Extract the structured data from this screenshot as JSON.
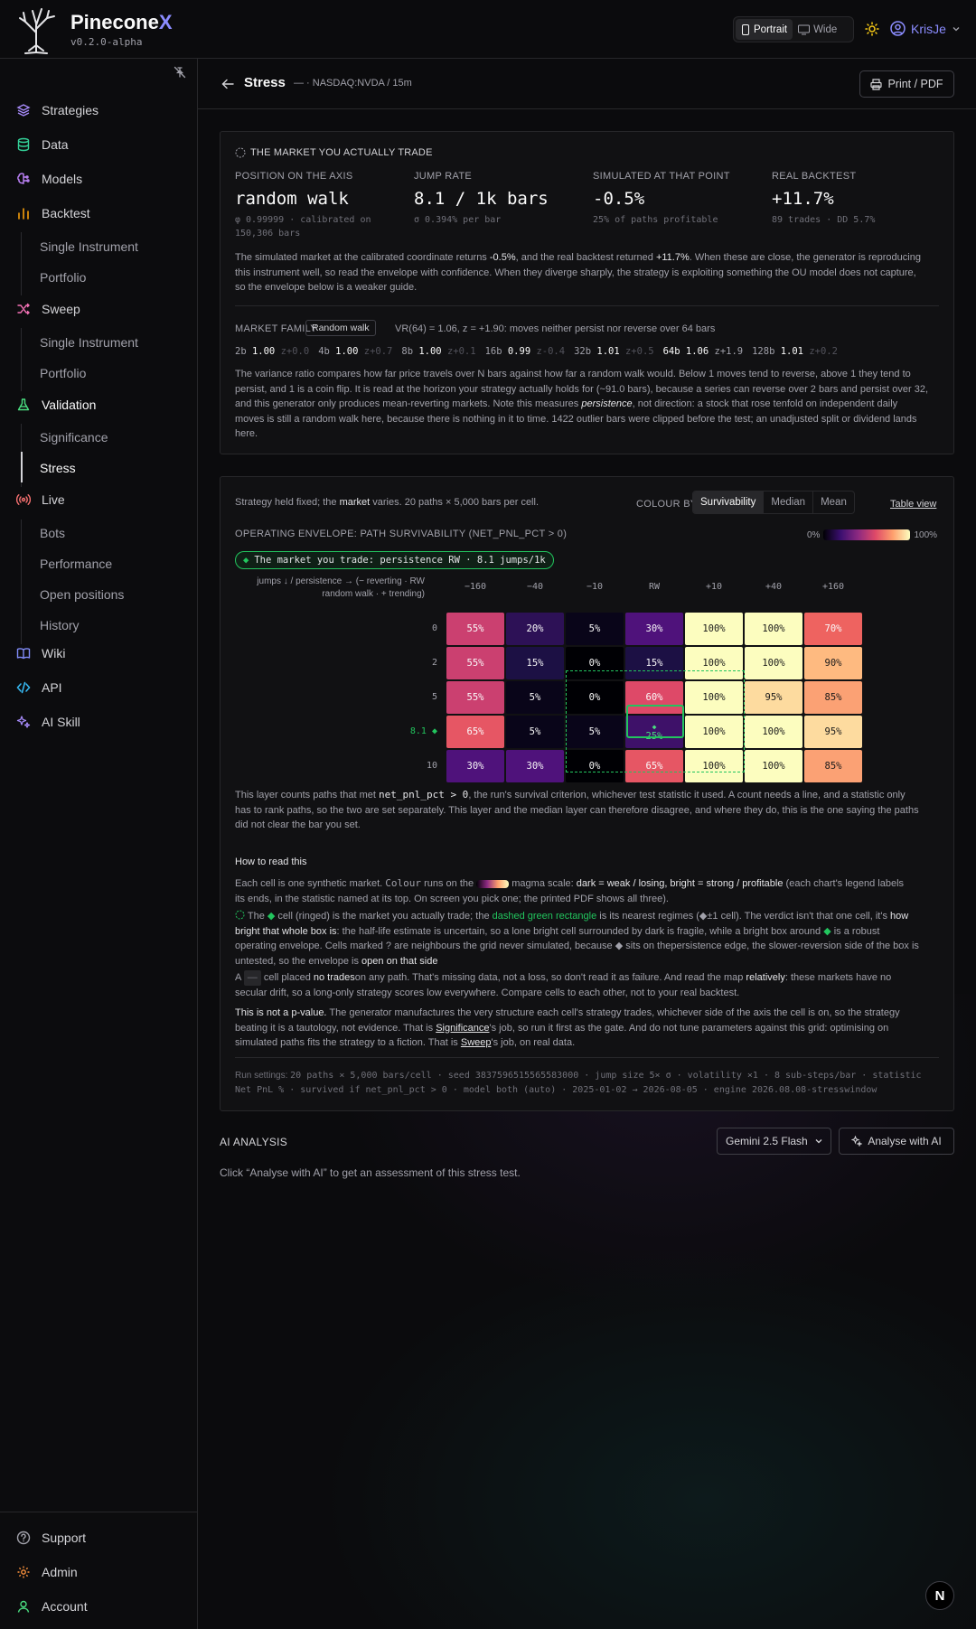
{
  "brand": {
    "name_main": "Pinecone",
    "name_x": "X",
    "version": "v0.2.0-alpha"
  },
  "view_toggle": {
    "portrait": "Portrait",
    "wide": "Wide"
  },
  "user": {
    "name": "KrisJe"
  },
  "sidebar": {
    "strategies": "Strategies",
    "data": "Data",
    "models": "Models",
    "backtest": "Backtest",
    "backtest_single": "Single Instrument",
    "backtest_portfolio": "Portfolio",
    "sweep": "Sweep",
    "sweep_single": "Single Instrument",
    "sweep_portfolio": "Portfolio",
    "validation": "Validation",
    "significance": "Significance",
    "stress": "Stress",
    "live": "Live",
    "bots": "Bots",
    "performance": "Performance",
    "open_positions": "Open positions",
    "history": "History",
    "wiki": "Wiki",
    "api": "API",
    "ai_skill": "AI Skill",
    "support": "Support",
    "admin": "Admin",
    "account": "Account"
  },
  "header": {
    "title": "Stress",
    "subtitle": "— · NASDAQ:NVDA / 15m",
    "print": "Print / PDF"
  },
  "market": {
    "heading": "THE MARKET YOU ACTUALLY TRADE",
    "position_label": "POSITION ON THE AXIS",
    "position_value": "random walk",
    "position_sub1": "φ 0.99999 · calibrated on",
    "position_sub2": "150,306 bars",
    "jump_label": "JUMP RATE",
    "jump_value": "8.1 / 1k bars",
    "jump_sub": "σ 0.394% per bar",
    "sim_label": "SIMULATED AT THAT POINT",
    "sim_value": "-0.5%",
    "sim_sub": "25% of paths profitable",
    "real_label": "REAL BACKTEST",
    "real_value": "+11.7%",
    "real_sub": "89 trades · DD 5.7%",
    "p1a": "The simulated market at the calibrated coordinate returns ",
    "p1b": "-0.5%",
    "p1c": ", and the real backtest returned ",
    "p1d": "+11.7%",
    "p1e": ". When these are close, the generator is reproducing",
    "p1_line2": "this instrument well, so read the envelope with confidence. When they diverge sharply, the strategy is exploiting something the OU model does not capture,",
    "p1_line3": "so the envelope below is a weaker guide.",
    "family_label": "MARKET FAMILY",
    "family_tag": "Random walk",
    "family_text": "VR(64) = 1.06, z = +1.90: moves neither persist nor reverse over 64 bars",
    "vr": [
      {
        "n": "2b",
        "v": "1.00",
        "z": "z+0.0"
      },
      {
        "n": "4b",
        "v": "1.00",
        "z": "z+0.7"
      },
      {
        "n": "8b",
        "v": "1.00",
        "z": "z+0.1"
      },
      {
        "n": "16b",
        "v": "0.99",
        "z": "z-0.4"
      },
      {
        "n": "32b",
        "v": "1.01",
        "z": "z+0.5"
      },
      {
        "n": "64b",
        "v": "1.06",
        "z": "z+1.9"
      },
      {
        "n": "128b",
        "v": "1.01",
        "z": "z+0.2"
      }
    ],
    "p2_l1": "The variance ratio compares how far price travels over N bars against how far a random walk would. Below 1 moves tend to reverse, above 1 they tend to",
    "p2_l2": "persist, and 1 is a coin flip. It is read at the horizon your strategy actually holds for (~91.0 bars), because a series can reverse over 2 bars and persist over 32,",
    "p2_l3a": "and this generator only produces mean-reverting markets. Note this measures ",
    "p2_l3b": "persistence",
    "p2_l3c": ", not direction: a stock that rose tenfold on independent daily",
    "p2_l4": "moves is still a random walk here, because there is nothing in it to time. 1422 outlier bars were clipped before the test; an unadjusted split or dividend lands",
    "p2_l5": "here."
  },
  "grid": {
    "intro_a": "Strategy held fixed; the ",
    "intro_b": "market",
    "intro_c": " varies. 20 paths × 5,000 bars per cell.",
    "colour_by": "COLOUR BY",
    "modes": [
      "Survivability",
      "Median",
      "Mean"
    ],
    "table_view": "Table view",
    "title": "OPERATING ENVELOPE: PATH SURVIVABILITY (NET_PNL_PCT > 0)",
    "legend_min": "0%",
    "legend_max": "100%",
    "pill": "The market you trade: persistence RW · 8.1 jumps/1k",
    "axis_l1": "jumps ↓ / persistence → (− reverting · RW",
    "axis_l2": "random walk · + trending)",
    "cols": [
      "−160",
      "−40",
      "−10",
      "RW",
      "+10",
      "+40",
      "+160"
    ],
    "rows": [
      "0",
      "2",
      "5",
      "8.1 ◆",
      "10"
    ],
    "marker": "◆",
    "cells": [
      [
        55,
        20,
        5,
        30,
        100,
        100,
        70
      ],
      [
        55,
        15,
        0,
        15,
        100,
        100,
        90
      ],
      [
        55,
        5,
        0,
        60,
        100,
        95,
        85
      ],
      [
        65,
        5,
        5,
        25,
        100,
        100,
        95
      ],
      [
        30,
        30,
        0,
        65,
        100,
        100,
        85
      ]
    ],
    "cell_labels": [
      [
        "55%",
        "20%",
        "5%",
        "30%",
        "100%",
        "100%",
        "70%"
      ],
      [
        "55%",
        "15%",
        "0%",
        "15%",
        "100%",
        "100%",
        "90%"
      ],
      [
        "55%",
        "5%",
        "0%",
        "60%",
        "100%",
        "95%",
        "85%"
      ],
      [
        "65%",
        "5%",
        "5%",
        "25%",
        "100%",
        "100%",
        "95%"
      ],
      [
        "30%",
        "30%",
        "0%",
        "65%",
        "100%",
        "100%",
        "85%"
      ]
    ],
    "layer_l1a": "This layer counts paths that met ",
    "layer_l1b": "net_pnl_pct > 0",
    "layer_l1c": ", the run's survival criterion, whichever test statistic it used. A count needs a line, and a statistic only",
    "layer_l2": "has to rank paths, so the two are set separately. This layer and the median layer can therefore disagree, and where they do, this is the one saying the paths",
    "layer_l3": "did not clear the bar you set.",
    "howto": "How to read this",
    "h1_l1a": "Each cell is one synthetic market. ",
    "h1_l1b": "Colour",
    "h1_l1c": " runs on the ",
    "h1_l1d": " magma scale: ",
    "h1_l1e": "dark = weak / losing, bright = strong / profitable",
    "h1_l1f": " (each chart's legend labels",
    "h1_l2": "its ends, in the statistic named at its top. On screen you pick one; the printed PDF shows all three).",
    "h2_l1a": " The ",
    "h2_l1b": " cell (ringed) is the market you actually trade; the ",
    "h2_l1c": "dashed green rectangle",
    "h2_l1d": " is its nearest regimes (◆±1 cell). The verdict isn't that one cell, it's ",
    "h2_l1e": "how",
    "h2_l2a": "bright that whole box is",
    "h2_l2b": ": the half-life estimate is uncertain, so a lone bright cell surrounded by dark is fragile, while a bright box around ",
    "h2_l2c": " is a robust",
    "h2_l3": "operating envelope. Cells marked ? are neighbours the grid never simulated, because ◆ sits on thepersistence edge, the slower-reversion side of the box is",
    "h2_l4a": "untested, so the envelope is ",
    "h2_l4b": "open on that side",
    "h3_l1a": "A ",
    "h3_l1b": "—",
    "h3_l1c": " cell placed ",
    "h3_l1d": "no trades",
    "h3_l1e": "on any path. That's missing data, not a loss, so don't read it as failure. And read the map ",
    "h3_l1f": "relatively",
    "h3_l1g": ": these markets have no",
    "h3_l2": "secular drift, so a long-only strategy scores low everywhere. Compare cells to each other, not to your real backtest.",
    "h4_l1a": "This is not a p-value.",
    "h4_l1b": " The generator manufactures the very structure each cell's strategy trades, whichever side of the axis the cell is on, so the strategy",
    "h4_l2a": "beating it is a tautology, not evidence. That is ",
    "h4_l2b": "Significance",
    "h4_l2c": "'s job, so run it first as the gate. And do not tune parameters against this grid: optimising on",
    "h4_l3a": "simulated paths fits the strategy to a fiction. That is ",
    "h4_l3b": "Sweep",
    "h4_l3c": "'s job, on real data.",
    "run_l1a": "Run settings: ",
    "run_l1b": "20 paths × 5,000 bars/cell · seed 3837596515565583000 · jump size 5× σ · volatility ×1 · 8 sub-steps/bar · statistic",
    "run_l2": "Net PnL % · survived if net_pnl_pct > 0 · model both (auto) · 2025-01-02 → 2026-08-05 · engine 2026.08.08-stresswindow"
  },
  "ai": {
    "title": "AI ANALYSIS",
    "model": "Gemini 2.5 Flash",
    "button": "Analyse with AI",
    "hint": "Click “Analyse with AI” to get an assessment of this stress test."
  },
  "colors": {
    "accent": "#8b8cff",
    "green": "#22c55e"
  }
}
